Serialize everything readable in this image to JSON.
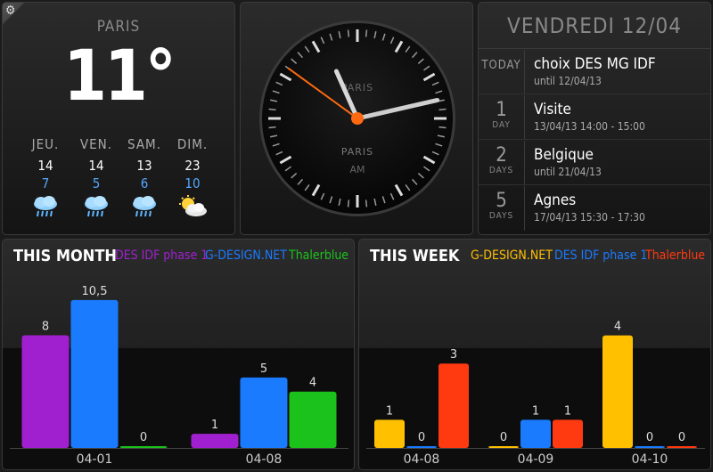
{
  "weather": {
    "city": "PARIS",
    "temperature": "11°",
    "forecast": [
      {
        "day": "JEU.",
        "high": "14",
        "low": "7",
        "icon": "rain-icon"
      },
      {
        "day": "VEN.",
        "high": "14",
        "low": "5",
        "icon": "rain-icon"
      },
      {
        "day": "SAM.",
        "high": "13",
        "low": "6",
        "icon": "rain-icon"
      },
      {
        "day": "DIM.",
        "high": "23",
        "low": "10",
        "icon": "sun-cloud-icon"
      }
    ]
  },
  "clock": {
    "label_top": "PARIS",
    "label_city": "PARIS",
    "label_ampm": "AM",
    "time": {
      "hour": 11,
      "minute": 12,
      "second": 51
    }
  },
  "agenda": {
    "date_header": "VENDREDI 12/04",
    "events": [
      {
        "count": "",
        "unit": "TODAY",
        "title": "choix DES MG IDF",
        "subtitle": "until 12/04/13"
      },
      {
        "count": "1",
        "unit": "DAY",
        "title": "Visite",
        "subtitle": "13/04/13 14:00 - 15:00"
      },
      {
        "count": "2",
        "unit": "DAYS",
        "title": "Belgique",
        "subtitle": "until 21/04/13"
      },
      {
        "count": "5",
        "unit": "DAYS",
        "title": "Agnes",
        "subtitle": "17/04/13 15:30 - 17:30"
      }
    ]
  },
  "charts": {
    "month": {
      "title": "THIS MONTH",
      "legend": [
        {
          "label": "DES IDF phase 1",
          "color": "#a020d0"
        },
        {
          "label": "G-DESIGN.NET",
          "color": "#1a7bff"
        },
        {
          "label": "Thalerblue",
          "color": "#1cc21c"
        }
      ]
    },
    "week": {
      "title": "THIS WEEK",
      "legend": [
        {
          "label": "G-DESIGN.NET",
          "color": "#ffc000"
        },
        {
          "label": "DES IDF phase 1",
          "color": "#1a7bff"
        },
        {
          "label": "Thalerblue",
          "color": "#ff3a10"
        }
      ]
    }
  },
  "chart_data": [
    {
      "type": "bar",
      "title": "THIS MONTH",
      "categories": [
        "04-01",
        "04-08"
      ],
      "series": [
        {
          "name": "DES IDF phase 1",
          "values": [
            8,
            1
          ],
          "color": "#a020d0"
        },
        {
          "name": "G-DESIGN.NET",
          "values": [
            10.5,
            5
          ],
          "color": "#1a7bff"
        },
        {
          "name": "Thalerblue",
          "values": [
            0,
            4
          ],
          "color": "#1cc21c"
        }
      ],
      "value_labels": [
        [
          "8",
          "1"
        ],
        [
          "10,5",
          "5"
        ],
        [
          "0",
          "4"
        ]
      ],
      "ylim": [
        0,
        11
      ]
    },
    {
      "type": "bar",
      "title": "THIS WEEK",
      "categories": [
        "04-08",
        "04-09",
        "04-10"
      ],
      "series": [
        {
          "name": "G-DESIGN.NET",
          "values": [
            1,
            0,
            4
          ],
          "color": "#ffc000"
        },
        {
          "name": "DES IDF phase 1",
          "values": [
            0,
            1,
            0
          ],
          "color": "#1a7bff"
        },
        {
          "name": "Thalerblue",
          "values": [
            3,
            1,
            0
          ],
          "color": "#ff3a10"
        }
      ],
      "value_labels": [
        [
          "1",
          "0",
          "4"
        ],
        [
          "0",
          "1",
          "0"
        ],
        [
          "3",
          "1",
          "0"
        ]
      ],
      "ylim": [
        0,
        4.4
      ]
    }
  ]
}
